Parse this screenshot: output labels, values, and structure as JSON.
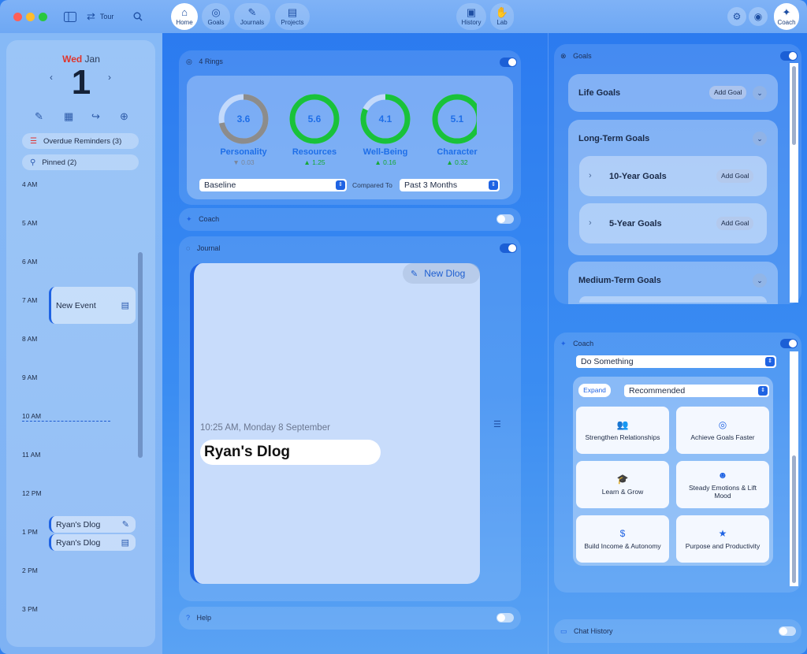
{
  "toolbar": {
    "tour_label": "Tour",
    "nav": [
      {
        "label": "Home",
        "icon": "home-icon"
      },
      {
        "label": "Goals",
        "icon": "target-icon"
      },
      {
        "label": "Journals",
        "icon": "journal-icon"
      },
      {
        "label": "Projects",
        "icon": "clipboard-icon"
      }
    ],
    "history_label": "History",
    "lab_label": "Lab",
    "coach_label": "Coach"
  },
  "calendar": {
    "weekday": "Wed",
    "month": "Jan",
    "day": "1",
    "overdue_label": "Overdue Reminders (3)",
    "pinned_label": "Pinned (2)",
    "hours": [
      "4 AM",
      "5 AM",
      "6 AM",
      "7 AM",
      "8 AM",
      "9 AM",
      "10 AM",
      "11 AM",
      "12 PM",
      "1 PM",
      "2 PM",
      "3 PM"
    ],
    "events": [
      {
        "title": "New Event"
      },
      {
        "title": "Ryan's Dlog"
      },
      {
        "title": "Ryan's Dlog"
      }
    ]
  },
  "rings": {
    "title": "4 Rings",
    "items": [
      {
        "label": "Personality",
        "value": "3.6",
        "delta": "▼ 0.03",
        "fraction": 0.72,
        "color": "#8c8c8c",
        "delta_color": "#7a8599"
      },
      {
        "label": "Resources",
        "value": "5.6",
        "delta": "▲ 1.25",
        "fraction": 1.0,
        "color": "#19c23a",
        "delta_color": "#15a834"
      },
      {
        "label": "Well-Being",
        "value": "4.1",
        "delta": "▲ 0.16",
        "fraction": 0.82,
        "color": "#19c23a",
        "delta_color": "#15a834"
      },
      {
        "label": "Character",
        "value": "5.1",
        "delta": "▲ 0.32",
        "fraction": 1.0,
        "color": "#19c23a",
        "delta_color": "#15a834"
      }
    ],
    "baseline": "Baseline",
    "compared_to": "Compared To",
    "period": "Past 3 Months"
  },
  "coach_bar_label": "Coach",
  "journal": {
    "title": "Journal",
    "new_dlog": "New Dlog",
    "date": "10:25 AM, Monday 8 September",
    "entry_title": "Ryan's Dlog"
  },
  "help_label": "Help",
  "goals": {
    "title": "Goals",
    "life": "Life Goals",
    "long_term": "Long-Term Goals",
    "ten_year": "10-Year Goals",
    "five_year": "5-Year Goals",
    "medium_term": "Medium-Term Goals",
    "add_goal": "Add Goal"
  },
  "coach": {
    "title": "Coach",
    "action": "Do Something",
    "expand": "Expand",
    "filter": "Recommended",
    "cards": [
      {
        "label": "Strengthen Relationships",
        "icon": "people-icon"
      },
      {
        "label": "Achieve Goals Faster",
        "icon": "target-icon"
      },
      {
        "label": "Learn & Grow",
        "icon": "graduation-cap-icon"
      },
      {
        "label": "Steady Emotions & Lift Mood",
        "icon": "smiley-icon"
      },
      {
        "label": "Build Income & Autonomy",
        "icon": "dollar-icon"
      },
      {
        "label": "Purpose and Productivity",
        "icon": "star-icon"
      }
    ]
  },
  "chat_history_label": "Chat History"
}
